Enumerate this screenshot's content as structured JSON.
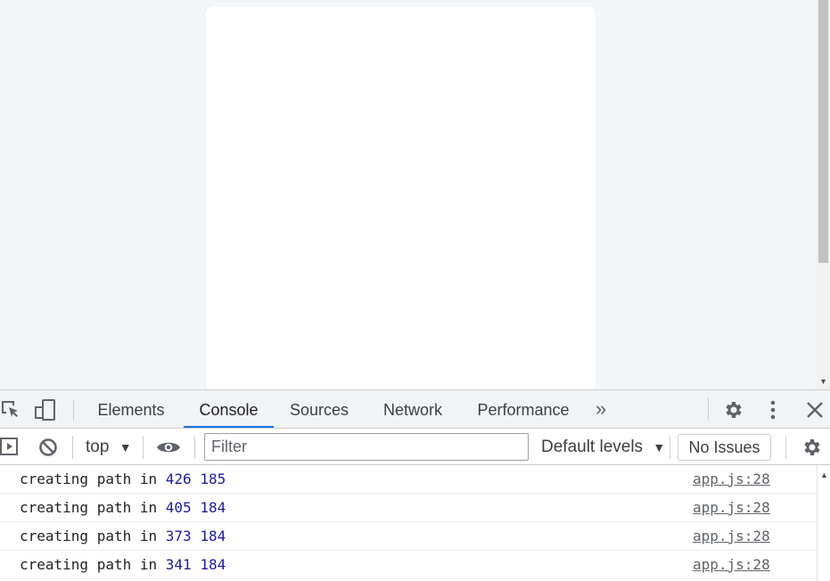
{
  "devtools": {
    "tabs": [
      {
        "label": "Elements",
        "active": false
      },
      {
        "label": "Console",
        "active": true
      },
      {
        "label": "Sources",
        "active": false
      },
      {
        "label": "Network",
        "active": false
      },
      {
        "label": "Performance",
        "active": false
      }
    ],
    "more_tabs_glyph": "»",
    "accent_color": "#1a73e8"
  },
  "console_toolbar": {
    "context_label": "top",
    "filter_placeholder": "Filter",
    "levels_label": "Default levels",
    "issues_label": "No Issues"
  },
  "console_messages": [
    {
      "text": "creating path in",
      "x": "426",
      "y": "185",
      "source": "app.js:28"
    },
    {
      "text": "creating path in",
      "x": "405",
      "y": "184",
      "source": "app.js:28"
    },
    {
      "text": "creating path in",
      "x": "373",
      "y": "184",
      "source": "app.js:28"
    },
    {
      "text": "creating path in",
      "x": "341",
      "y": "184",
      "source": "app.js:28"
    }
  ]
}
